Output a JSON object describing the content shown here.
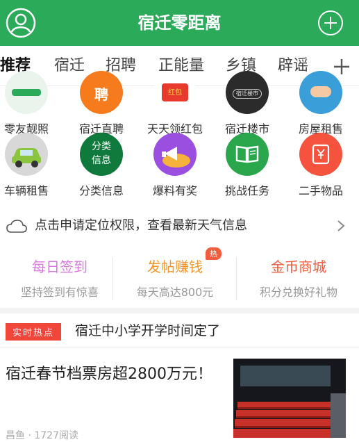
{
  "header": {
    "title": "宿迁零距离"
  },
  "tabs": [
    {
      "label": "推荐",
      "active": true
    },
    {
      "label": "宿迁"
    },
    {
      "label": "招聘"
    },
    {
      "label": "正能量"
    },
    {
      "label": "乡镇"
    },
    {
      "label": "辟谣"
    }
  ],
  "grid": [
    {
      "label": "零友靓照",
      "icon": "photo-icon"
    },
    {
      "label": "宿迁直聘",
      "icon": "job-icon"
    },
    {
      "label": "天天领红包",
      "icon": "red-envelope-icon",
      "inner_text": "红包"
    },
    {
      "label": "宿迁楼市",
      "icon": "building-icon",
      "inner_text": "宿迁楼市"
    },
    {
      "label": "房屋租售",
      "icon": "house-icon"
    },
    {
      "label": "车辆租售",
      "icon": "car-icon"
    },
    {
      "label": "分类信息",
      "icon": "category-icon",
      "inner_text": "分类\n信息"
    },
    {
      "label": "爆料有奖",
      "icon": "megaphone-icon"
    },
    {
      "label": "挑战任务",
      "icon": "book-icon"
    },
    {
      "label": "二手物品",
      "icon": "yen-bag-icon"
    }
  ],
  "weather": {
    "text": "点击申请定位权限，查看最新天气信息"
  },
  "actions": [
    {
      "title": "每日签到",
      "sub": "坚持签到有惊喜",
      "color": "#d77be0"
    },
    {
      "title": "发帖赚钱",
      "sub": "每天高达800元",
      "color": "#f0962a",
      "badge": "热"
    },
    {
      "title": "金币商城",
      "sub": "积分兑换好礼物",
      "color": "#f05a3a"
    }
  ],
  "hot": {
    "badge": "实时热点",
    "text": "宿迁中小学开学时间定了"
  },
  "news": {
    "title": "宿迁春节档票房超2800万元！",
    "meta": "昌鱼 · 1727阅读"
  },
  "colors": {
    "brand": "#2baa5a"
  }
}
